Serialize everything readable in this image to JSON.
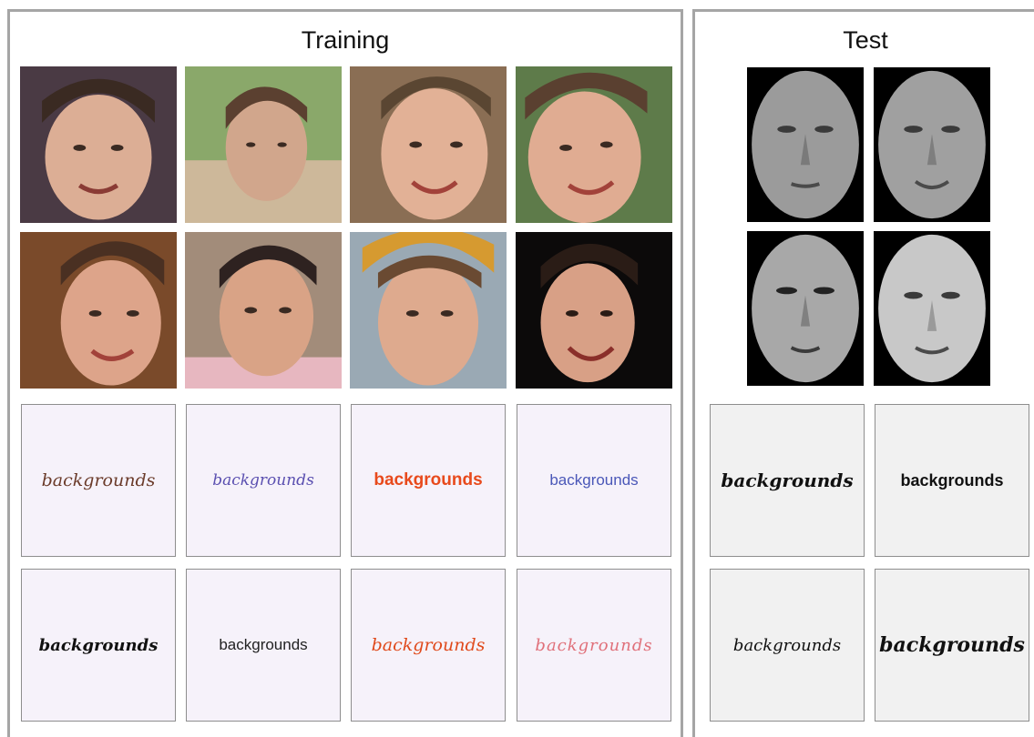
{
  "panels": {
    "training": {
      "title": "Training"
    },
    "test": {
      "title": "Test"
    }
  },
  "handwriting": {
    "training": [
      {
        "text": "backgrounds",
        "color": "#6b3b2a",
        "font": "cursive-thin"
      },
      {
        "text": "backgrounds",
        "color": "#5a4fb0",
        "font": "cursive-thin"
      },
      {
        "text": "backgrounds",
        "color": "#e84a1c",
        "font": "bold"
      },
      {
        "text": "backgrounds",
        "color": "#4a57b8",
        "font": "thin"
      },
      {
        "text": "backgrounds",
        "color": "#111111",
        "font": "bold-script"
      },
      {
        "text": "backgrounds",
        "color": "#222222",
        "font": "thin"
      },
      {
        "text": "backgrounds",
        "color": "#e04a1c",
        "font": "script"
      },
      {
        "text": "backgrounds",
        "color": "#e0707a",
        "font": "cursive-thin"
      }
    ],
    "test": [
      {
        "text": "backgrounds",
        "color": "#111111",
        "font": "bold-script"
      },
      {
        "text": "backgrounds",
        "color": "#111111",
        "font": "bold"
      },
      {
        "text": "backgrounds",
        "color": "#111111",
        "font": "script"
      },
      {
        "text": "backgrounds",
        "color": "#111111",
        "font": "bold-script"
      }
    ]
  },
  "colors": {
    "panel_border": "#a5a5a5",
    "training_bg": "#f6f2fa",
    "test_bg": "#f1f1f1"
  }
}
